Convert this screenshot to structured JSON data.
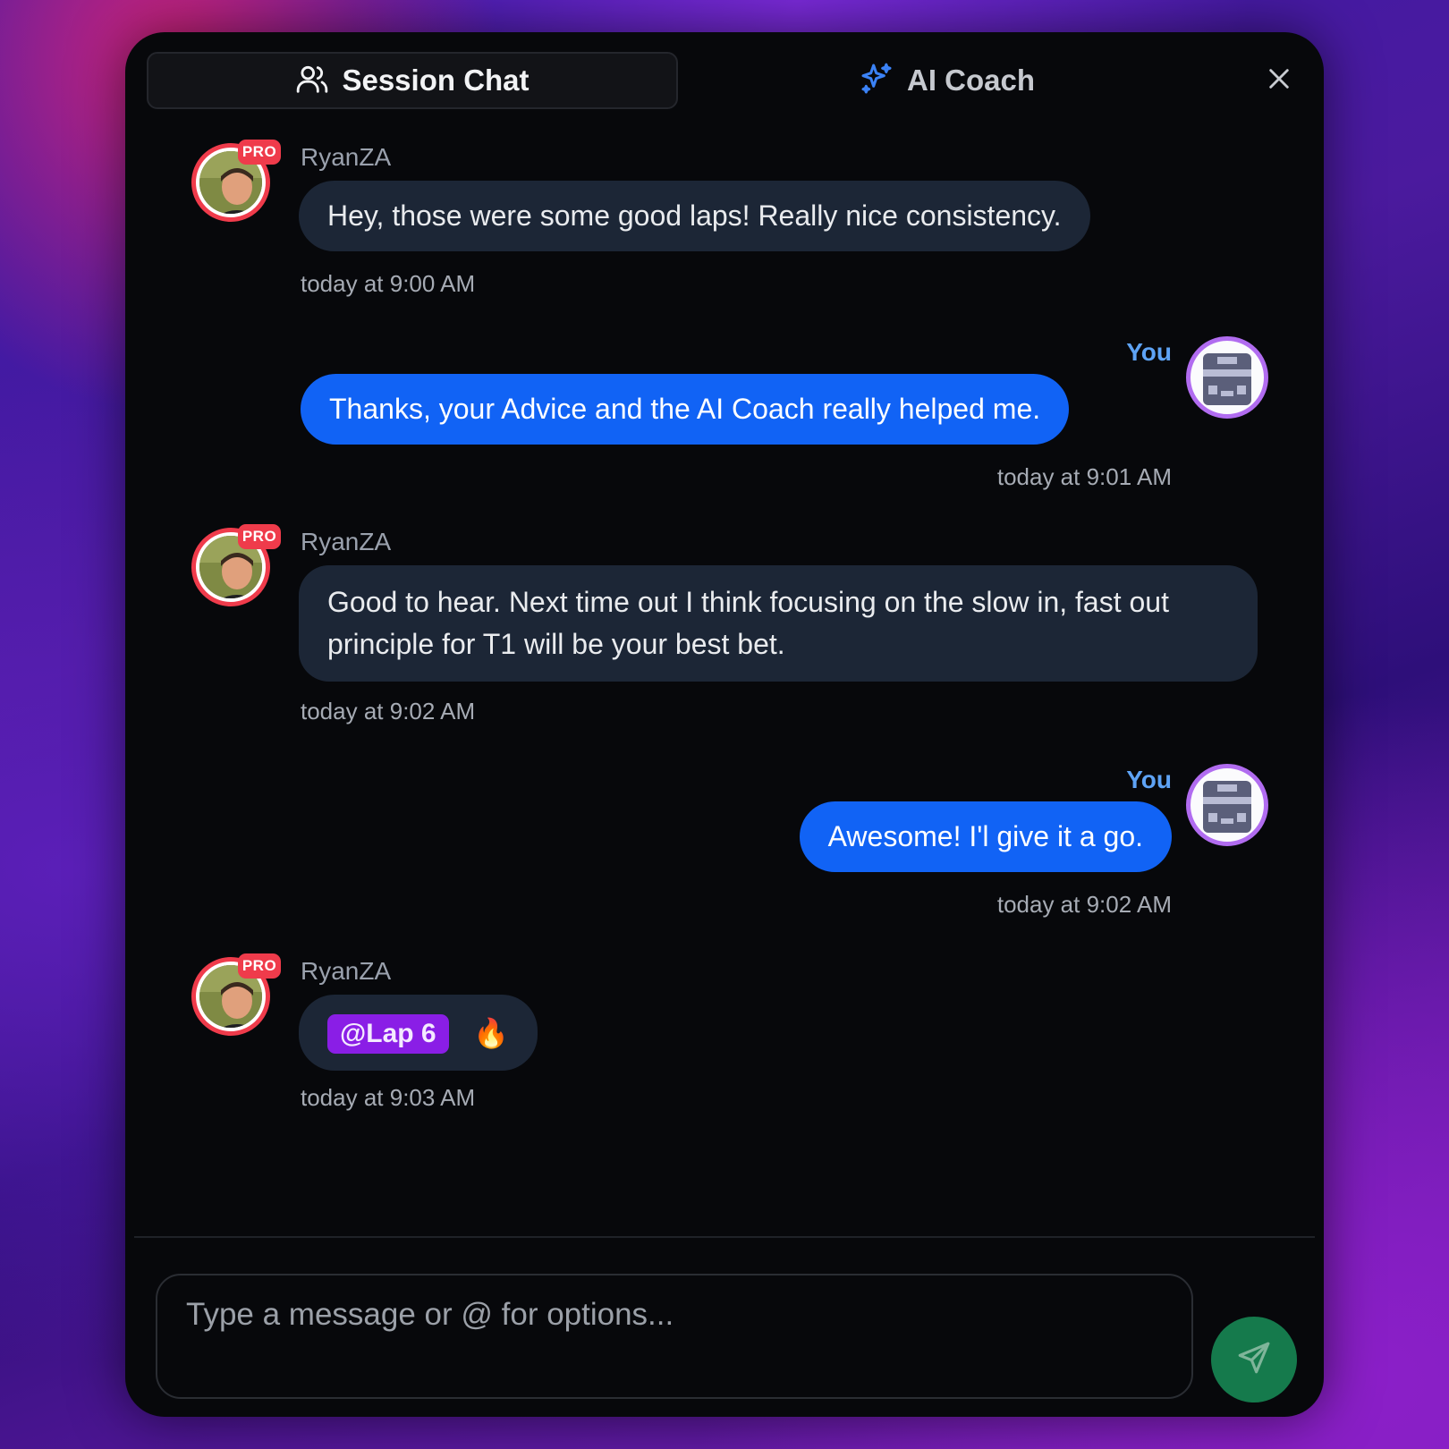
{
  "header": {
    "session_chat_label": "Session Chat",
    "ai_coach_label": "AI Coach"
  },
  "messages": [
    {
      "sender": "RyanZA",
      "badge": "PRO",
      "text": "Hey, those were some good laps! Really nice consistency.",
      "time": "today at 9:00 AM"
    },
    {
      "sender": "You",
      "text": "Thanks, your Advice and the AI Coach really helped me.",
      "time": "today at 9:01 AM"
    },
    {
      "sender": "RyanZA",
      "badge": "PRO",
      "text": "Good to hear. Next time out I think focusing on the slow in, fast out principle for T1 will be your best bet.",
      "time": "today at 9:02 AM"
    },
    {
      "sender": "You",
      "text": "Awesome! I'l give it a go.",
      "time": "today at 9:02 AM"
    },
    {
      "sender": "RyanZA",
      "badge": "PRO",
      "lap_tag": "@Lap 6",
      "emoji": "🔥",
      "time": "today at 9:03 AM"
    }
  ],
  "composer": {
    "placeholder": "Type a message or @ for options..."
  },
  "colors": {
    "panel": "#07080b",
    "other_bubble": "#1c2636",
    "my_bubble": "#1163f5",
    "pro_badge": "#ef3b4b",
    "you_label": "#5ea3f5",
    "lap_tag": "#8a1ee6",
    "send_button": "#157a4c",
    "ai_coach_icon": "#3b82f6"
  },
  "icons": {
    "session_chat": "users-icon",
    "ai_coach": "sparkles-icon",
    "close": "close-icon",
    "send": "send-icon"
  }
}
